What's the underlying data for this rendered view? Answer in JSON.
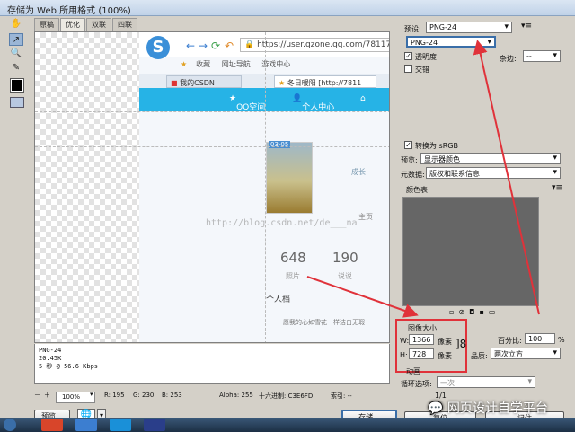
{
  "window": {
    "title": "存储为 Web 所用格式 (100%)"
  },
  "tabs": [
    "原稿",
    "优化",
    "双联",
    "四联"
  ],
  "browser": {
    "url": "https://user.qzone.qq.com/78117",
    "bookmarks": [
      "收藏",
      "网址导航",
      "游戏中心"
    ],
    "tab1": "我的CSDN",
    "tab2": "冬日暖阳 [http://7811",
    "qq_brand": "QQ空间",
    "qq_center": "个人中心",
    "photo_badge": "03-05",
    "stat1_value": "648",
    "stat1_label": "照片",
    "stat2_value": "190",
    "stat2_label": "说说",
    "profile_title": "个人档",
    "profile_text": "愿我的心如雪花一样洁白无瑕",
    "main_label": "主页",
    "side_label": "成长",
    "watermark": "http://blog.csdn.net/de___na"
  },
  "info": {
    "format": "PNG-24",
    "size": "20.45K",
    "time": "5 秒 @ 56.6 Kbps"
  },
  "status": {
    "zoom": "100%",
    "r": "R: 195",
    "g": "G: 230",
    "b": "B: 253",
    "alpha": "Alpha: 255",
    "hex": "十六进制: C3E6FD",
    "index": "索引: --"
  },
  "buttons": {
    "preview": "预览...",
    "save": "存储...",
    "reset": "复位",
    "remember": "记住"
  },
  "right": {
    "preset_label": "预设:",
    "preset_value": "PNG-24",
    "format_value": "PNG-24",
    "transparency": "透明度",
    "interlaced": "交错",
    "matte_label": "杂边:",
    "matte_value": "--",
    "convert_srgb": "转换为 sRGB",
    "preview_label": "预览:",
    "preview_value": "显示器颜色",
    "metadata_label": "元数据:",
    "metadata_value": "版权和联系信息",
    "color_table": "颜色表",
    "image_size": "图像大小",
    "w_label": "W:",
    "w_value": "1366",
    "h_label": "H:",
    "h_value": "728",
    "unit": "像素",
    "percent_label": "百分比:",
    "percent_value": "100",
    "percent_unit": "%",
    "quality_label": "品质:",
    "quality_value": "两次立方",
    "animation": "动画",
    "loop_label": "循环选项:",
    "loop_value": "一次",
    "frame": "1/1"
  },
  "overlay": {
    "wechat": "网页设计自学平台"
  },
  "colors": {
    "annotation": "#e0323a",
    "qq_blue": "#26b3e6"
  }
}
